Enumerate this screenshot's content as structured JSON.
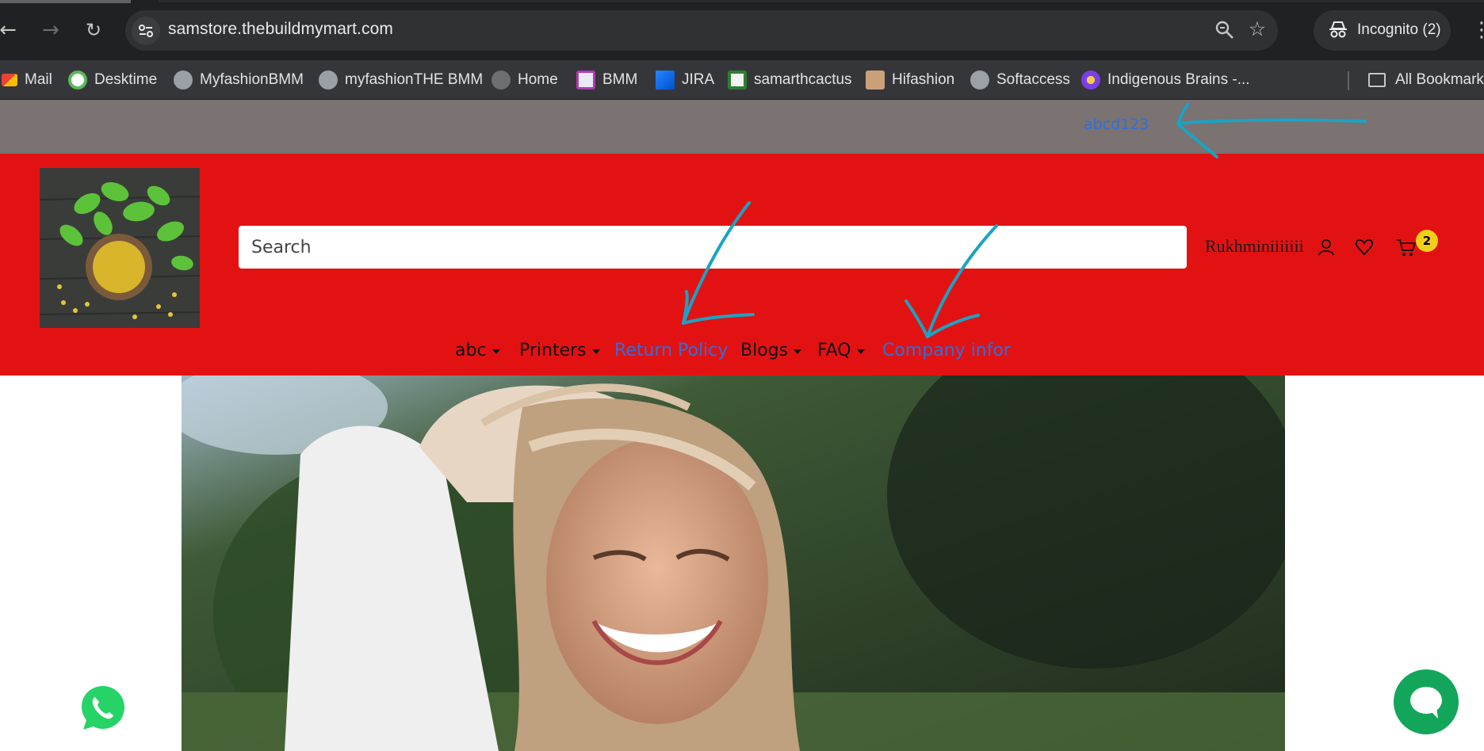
{
  "browser": {
    "url": "samstore.thebuildmymart.com",
    "incognito_label": "Incognito (2)",
    "bookmarks": [
      {
        "label": "Mail",
        "icon": "gmail-icon",
        "color": "#ea4335"
      },
      {
        "label": "Desktime",
        "icon": "desktime-icon",
        "color": "#5cb85c"
      },
      {
        "label": "MyfashionBMM",
        "icon": "globe-icon",
        "color": "#9aa0a6"
      },
      {
        "label": "myfashionTHE BMM",
        "icon": "globe-icon",
        "color": "#9aa0a6"
      },
      {
        "label": "Home",
        "icon": "globe-icon",
        "color": "#6b6f73"
      },
      {
        "label": "BMM",
        "icon": "bmm-icon",
        "color": "#e9e9f5"
      },
      {
        "label": "JIRA",
        "icon": "jira-icon",
        "color": "#2684ff"
      },
      {
        "label": "samarthcactus",
        "icon": "cactus-icon",
        "color": "#f3f3f3"
      },
      {
        "label": "Hifashion",
        "icon": "fashion-icon",
        "color": "#caa07a"
      },
      {
        "label": "Softaccess",
        "icon": "globe-icon",
        "color": "#9aa0a6"
      },
      {
        "label": "Indigenous Brains -...",
        "icon": "brain-icon",
        "color": "#7b3fe4"
      }
    ],
    "all_bookmarks": "All Bookmarks"
  },
  "site": {
    "topbar_link": "abcd123",
    "search_placeholder": "Search",
    "username": "Rukhminiiiiiii",
    "cart_count": "2",
    "menu": [
      {
        "label": "abc",
        "dropdown": true
      },
      {
        "label": "Printers",
        "dropdown": true
      },
      {
        "label": "Return Policy",
        "dropdown": false
      },
      {
        "label": "Blogs",
        "dropdown": true
      },
      {
        "label": "FAQ",
        "dropdown": true
      },
      {
        "label": "Company infor",
        "dropdown": false
      }
    ]
  },
  "colors": {
    "header_red": "#e31212",
    "topbar_gray": "#7b7272",
    "link_blue": "#2f6fdb",
    "annotation_cyan": "#1aa3c4",
    "chat_green": "#13a65a",
    "cart_badge_yellow": "#f2d01a"
  }
}
